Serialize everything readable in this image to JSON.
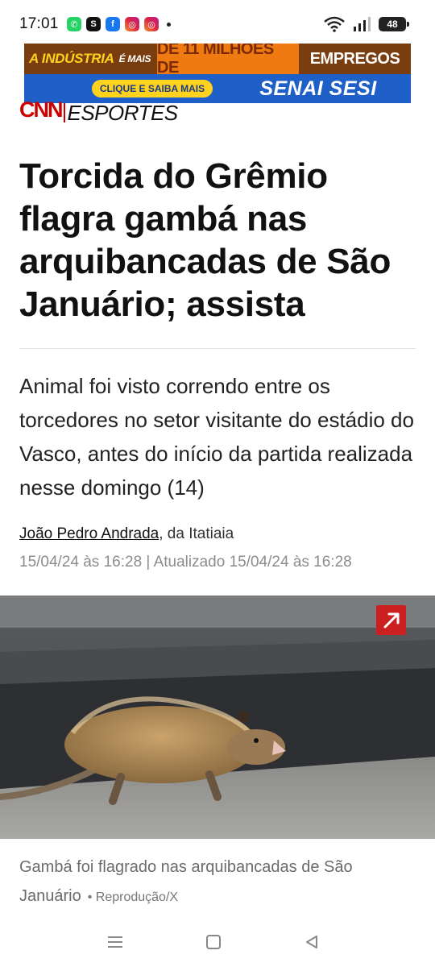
{
  "status_bar": {
    "time": "17:01",
    "battery": "48",
    "notification_icons": [
      "whatsapp-icon",
      "skype-icon",
      "facebook-icon",
      "instagram-icon",
      "instagram-icon"
    ]
  },
  "ad": {
    "line1_left": "A INDÚSTRIA",
    "line1_small": "É MAIS",
    "line1_center": "DE 11 MILHÕES DE",
    "line1_right": "EMPREGOS",
    "cta": "CLIQUE E SAIBA MAIS",
    "brand": "SENAI SESI"
  },
  "header": {
    "logo": "CNN",
    "section": "ESPORTES"
  },
  "article": {
    "headline": "Torcida do Grêmio flagra gambá nas arquibancadas de São Januário; assista",
    "subheadline": "Animal foi visto correndo entre os torcedores no setor visitante do estádio do Vasco, antes do início da partida realizada nesse domingo (14)",
    "author": "João Pedro Andrada",
    "author_suffix": ", da Itatiaia",
    "timestamp": "15/04/24 às 16:28 | Atualizado 15/04/24 às 16:28",
    "image_caption": "Gambá foi flagrado nas arquibancadas de São Januário",
    "image_credit": "• Reprodução/X"
  },
  "colors": {
    "cnn_red": "#cc0000",
    "ad_orange": "#ef7a12",
    "ad_brown": "#7a3d10",
    "ad_blue": "#1f5fc8"
  }
}
